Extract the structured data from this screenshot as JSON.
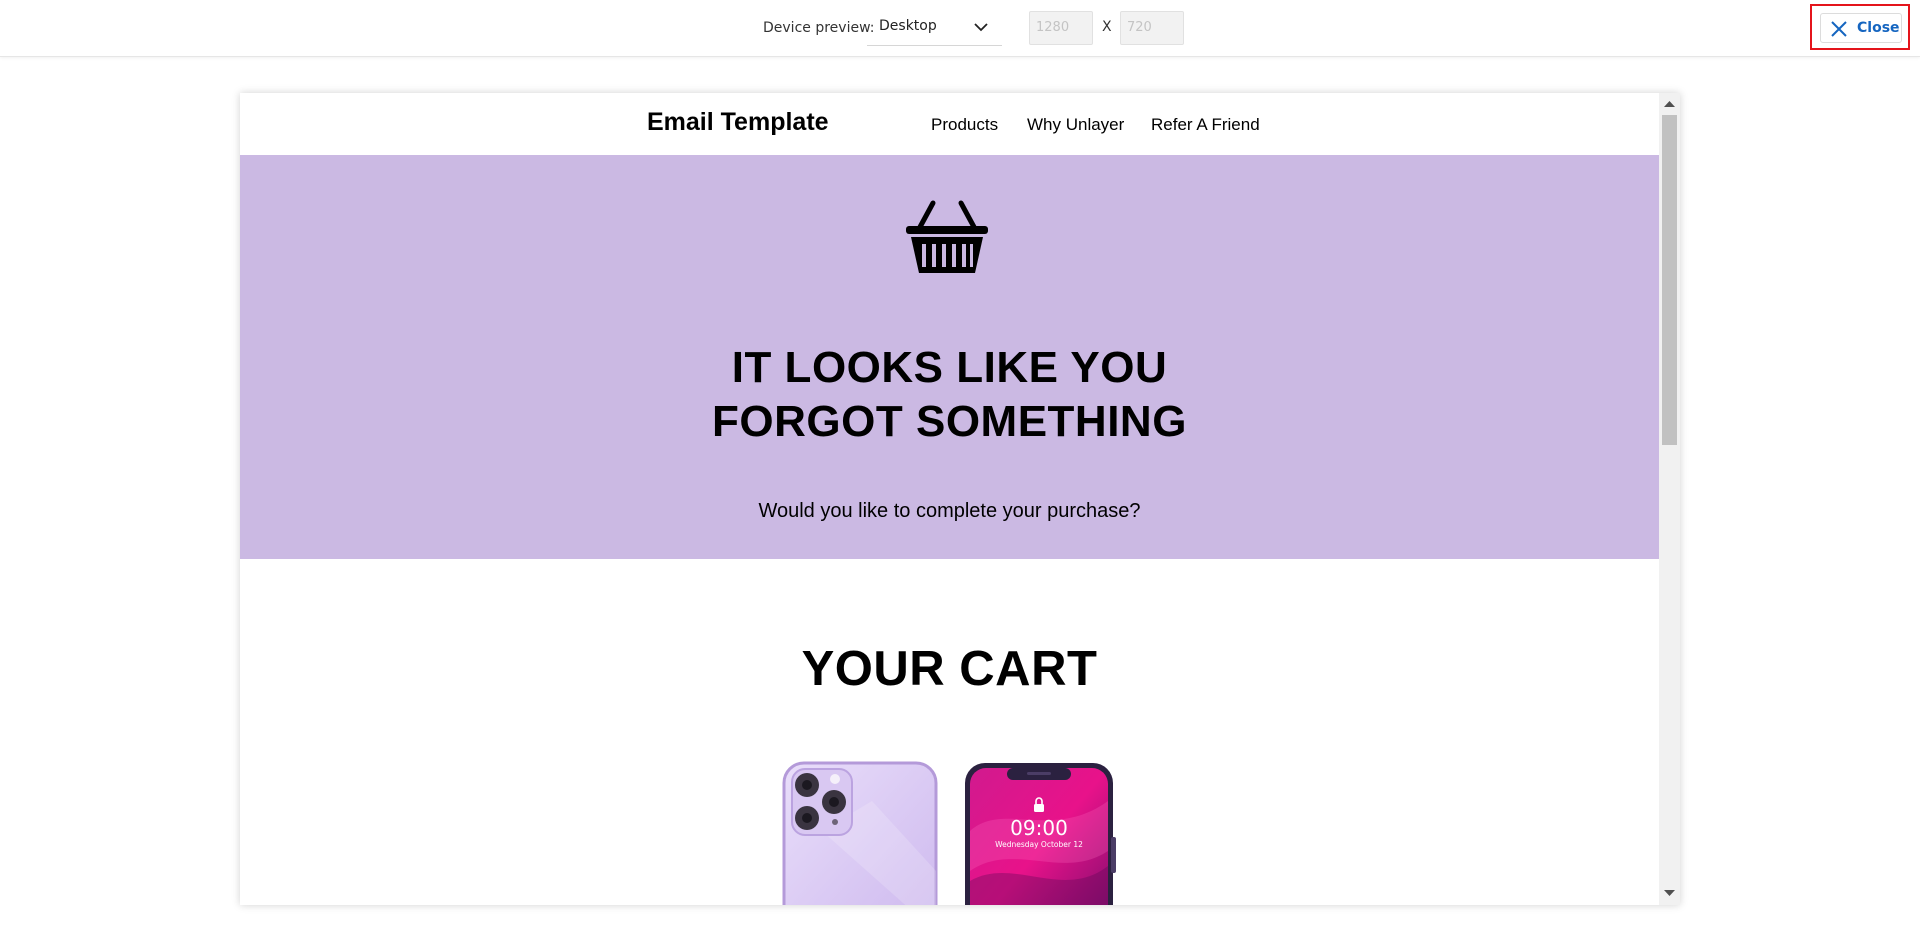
{
  "toolbar": {
    "device_preview_label": "Device preview:",
    "device_value": "Desktop",
    "width_placeholder": "1280",
    "height_placeholder": "720",
    "dim_separator": "X",
    "close_label": "Close"
  },
  "email": {
    "brand": "Email Template",
    "nav": [
      "Products",
      "Why Unlayer",
      "Refer A Friend"
    ],
    "hero_title_line1": "IT LOOKS LIKE YOU",
    "hero_title_line2": "FORGOT SOMETHING",
    "hero_subtitle": "Would you like to complete your purchase?",
    "cart_title": "YOUR CART",
    "phone_time": "09:00",
    "phone_date": "Wednesday October 12"
  },
  "colors": {
    "hero_background": "#cbb9e3",
    "close_accent": "#1565c0",
    "highlight_border": "#e4141b"
  },
  "icons": [
    "chevron-down-icon",
    "close-icon",
    "basket-icon",
    "scroll-up-icon",
    "scroll-down-icon"
  ]
}
